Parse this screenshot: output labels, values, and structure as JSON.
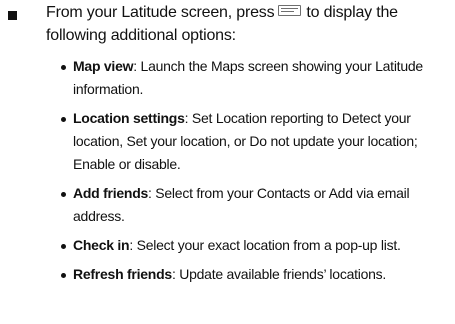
{
  "intro": {
    "text_before_icon": "From your Latitude screen, press",
    "icon": "menu-key-icon",
    "text_after_icon": "to display the following additional options:"
  },
  "options": [
    {
      "term": "Map view",
      "description": ": Launch the Maps screen showing your Latitude information."
    },
    {
      "term": "Location settings",
      "description": ": Set Location reporting to Detect your location, Set your location, or Do not update your location; Enable or disable."
    },
    {
      "term": "Add friends",
      "description": ": Select from your Contacts or Add via email address."
    },
    {
      "term": "Check in",
      "description": ": Select your exact location from a pop-up list."
    },
    {
      "term": "Refresh friends",
      "description": ": Update available friends’ locations."
    }
  ]
}
